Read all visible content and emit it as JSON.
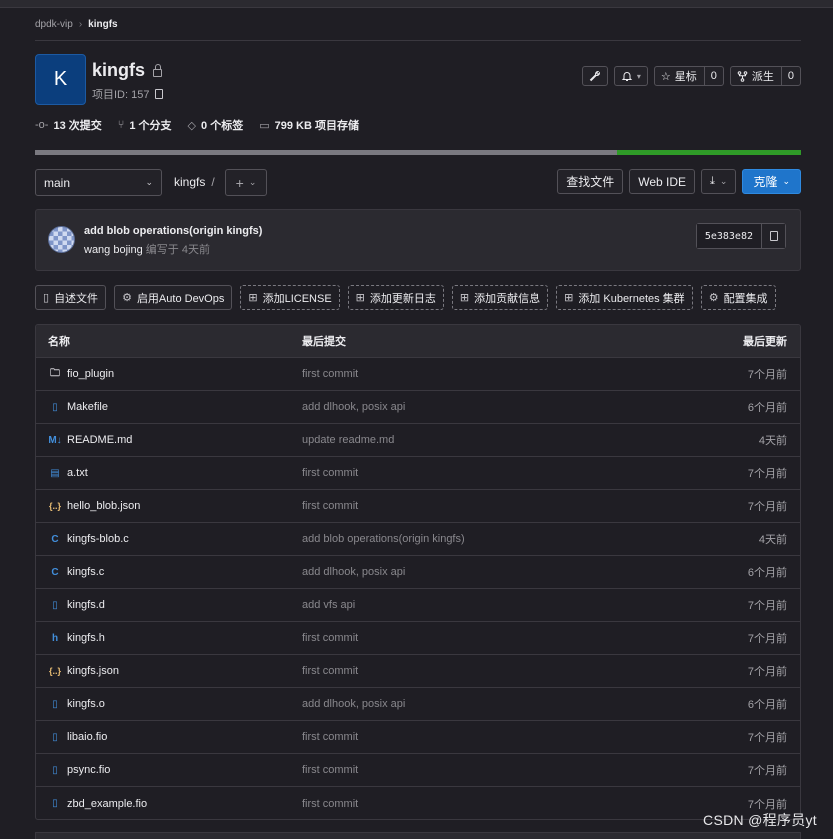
{
  "breadcrumb": {
    "group": "dpdk-vip",
    "project": "kingfs"
  },
  "project": {
    "initial": "K",
    "name": "kingfs",
    "id_label": "项目ID: 157"
  },
  "actions": {
    "star_label": "星标",
    "star_count": "0",
    "fork_label": "派生",
    "fork_count": "0"
  },
  "stats": {
    "commits": "13 次提交",
    "branches": "1 个分支",
    "tags": "0 个标签",
    "storage": "799 KB 项目存储"
  },
  "language_bar": {
    "segment_a": 0.76,
    "segment_b": 0.24,
    "color_a": "#7a7980",
    "color_b": "#2f9a28"
  },
  "toolbar": {
    "branch": "main",
    "path": "kingfs",
    "path_sep": "/",
    "find_file": "查找文件",
    "web_ide": "Web IDE",
    "clone": "克隆"
  },
  "last_commit": {
    "title": "add blob operations(origin kingfs)",
    "author": "wang bojing",
    "meta": "编写于 4天前",
    "sha": "5e383e82"
  },
  "quick_actions": [
    {
      "label": "自述文件",
      "icon": "file-icon"
    },
    {
      "label": "启用Auto DevOps",
      "icon": "gear-icon"
    },
    {
      "label": "添加LICENSE",
      "icon": "plus-square-icon"
    },
    {
      "label": "添加更新日志",
      "icon": "plus-square-icon"
    },
    {
      "label": "添加贡献信息",
      "icon": "plus-square-icon"
    },
    {
      "label": "添加 Kubernetes 集群",
      "icon": "plus-square-icon"
    },
    {
      "label": "配置集成",
      "icon": "gear-icon"
    }
  ],
  "table": {
    "headers": {
      "name": "名称",
      "commit": "最后提交",
      "updated": "最后更新"
    },
    "rows": [
      {
        "icon": "folder-icon",
        "name": "fio_plugin",
        "commit": "first commit",
        "updated": "7个月前"
      },
      {
        "icon": "file-icon",
        "name": "Makefile",
        "commit": "add dlhook, posix api",
        "updated": "6个月前"
      },
      {
        "icon": "markdown-icon",
        "name": "README.md",
        "commit": "update readme.md",
        "updated": "4天前"
      },
      {
        "icon": "text-file-icon",
        "name": "a.txt",
        "commit": "first commit",
        "updated": "7个月前"
      },
      {
        "icon": "json-icon",
        "name": "hello_blob.json",
        "commit": "first commit",
        "updated": "7个月前"
      },
      {
        "icon": "c-file-icon",
        "name": "kingfs-blob.c",
        "commit": "add blob operations(origin kingfs)",
        "updated": "4天前"
      },
      {
        "icon": "c-file-icon",
        "name": "kingfs.c",
        "commit": "add dlhook, posix api",
        "updated": "6个月前"
      },
      {
        "icon": "file-icon",
        "name": "kingfs.d",
        "commit": "add vfs api",
        "updated": "7个月前"
      },
      {
        "icon": "h-file-icon",
        "name": "kingfs.h",
        "commit": "first commit",
        "updated": "7个月前"
      },
      {
        "icon": "json-icon",
        "name": "kingfs.json",
        "commit": "first commit",
        "updated": "7个月前"
      },
      {
        "icon": "file-icon",
        "name": "kingfs.o",
        "commit": "add dlhook, posix api",
        "updated": "6个月前"
      },
      {
        "icon": "file-icon",
        "name": "libaio.fio",
        "commit": "first commit",
        "updated": "7个月前"
      },
      {
        "icon": "file-icon",
        "name": "psync.fio",
        "commit": "first commit",
        "updated": "7个月前"
      },
      {
        "icon": "file-icon",
        "name": "zbd_example.fio",
        "commit": "first commit",
        "updated": "7个月前"
      }
    ]
  },
  "watermark": "CSDN @程序员yt"
}
